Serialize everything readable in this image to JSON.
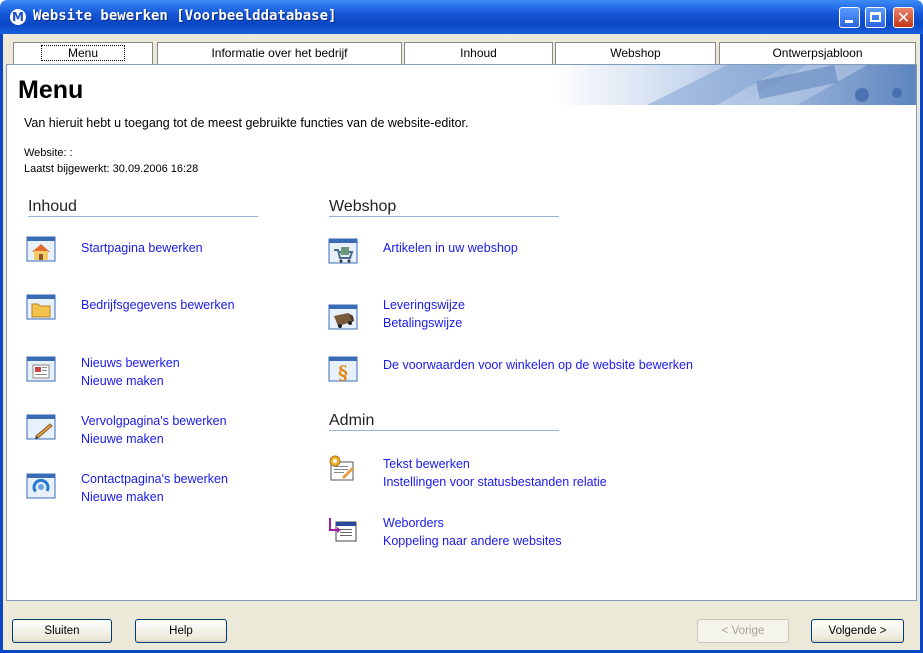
{
  "window": {
    "title": "Website bewerken [Voorbeelddatabase]"
  },
  "tabs": [
    {
      "label": "Menu"
    },
    {
      "label": "Informatie over het bedrijf"
    },
    {
      "label": "Inhoud"
    },
    {
      "label": "Webshop"
    },
    {
      "label": "Ontwerpsjabloon"
    }
  ],
  "page": {
    "title": "Menu",
    "intro": "Van hieruit hebt u toegang tot de meest gebruikte functies van de website-editor.",
    "website_label": "Website: :",
    "updated_label": "Laatst bijgewerkt: 30.09.2006 16:28"
  },
  "sections": {
    "inhoud": {
      "heading": "Inhoud",
      "items": [
        {
          "icon": "house-icon",
          "links": [
            "Startpagina bewerken"
          ]
        },
        {
          "icon": "folder-icon",
          "links": [
            "Bedrijfsgegevens bewerken"
          ]
        },
        {
          "icon": "newspaper-icon",
          "links": [
            "Nieuws bewerken",
            "Nieuwe maken"
          ]
        },
        {
          "icon": "pen-page-icon",
          "links": [
            "Vervolgpagina's bewerken",
            "Nieuwe maken"
          ]
        },
        {
          "icon": "contact-icon",
          "links": [
            "Contactpagina's bewerken",
            "Nieuwe maken"
          ]
        }
      ]
    },
    "webshop": {
      "heading": "Webshop",
      "items": [
        {
          "icon": "cart-icon",
          "links": [
            "Artikelen in uw webshop"
          ]
        },
        {
          "icon": "truck-icon",
          "links": [
            "Leveringswijze",
            "Betalingswijze"
          ]
        },
        {
          "icon": "paragraph-icon",
          "links": [
            "De voorwaarden voor winkelen op de website bewerken"
          ]
        }
      ]
    },
    "admin": {
      "heading": "Admin",
      "items": [
        {
          "icon": "settings-doc-icon",
          "links": [
            "Tekst bewerken",
            "Instellingen voor statusbestanden relatie"
          ]
        },
        {
          "icon": "weborders-icon",
          "links": [
            "Weborders",
            "Koppeling naar andere websites"
          ]
        }
      ]
    }
  },
  "buttons": {
    "close": "Sluiten",
    "help": "Help",
    "prev": "< Vorige",
    "next": "Volgende >"
  },
  "colors": {
    "titlebar": "#0b47c4",
    "link": "#1a1aeb",
    "frame": "#ece9d8"
  }
}
